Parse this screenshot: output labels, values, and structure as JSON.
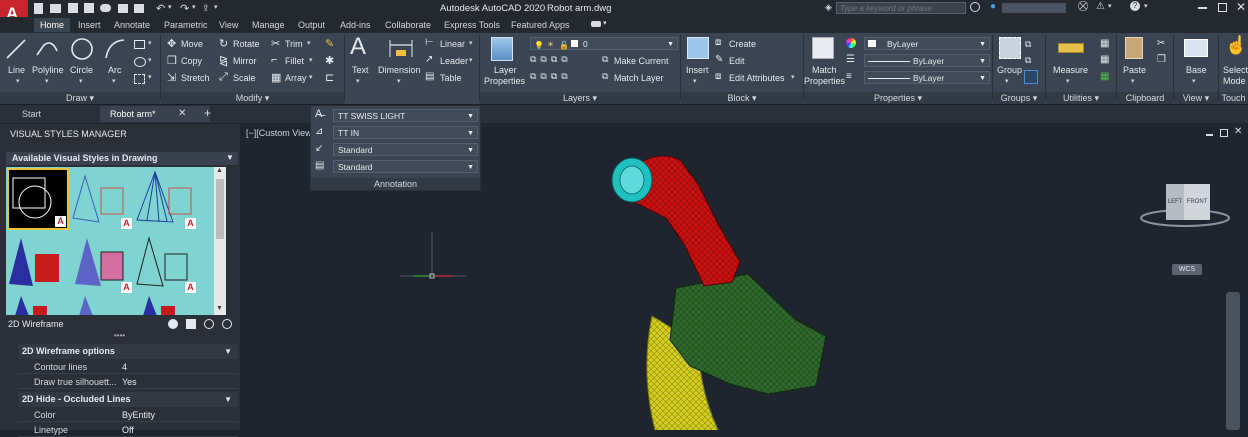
{
  "app": {
    "logo_letter": "A",
    "title": "Autodesk AutoCAD 2020",
    "filename": "Robot arm.dwg",
    "search_placeholder": "Type a keyword or phrase"
  },
  "ribbon_tabs": [
    "Home",
    "Insert",
    "Annotate",
    "Parametric",
    "View",
    "Manage",
    "Output",
    "Add-ins",
    "Collaborate",
    "Express Tools",
    "Featured Apps"
  ],
  "draw": {
    "label": "Draw",
    "line": "Line",
    "polyline": "Polyline",
    "circle": "Circle",
    "arc": "Arc"
  },
  "modify": {
    "label": "Modify",
    "move": "Move",
    "rotate": "Rotate",
    "trim": "Trim",
    "copy": "Copy",
    "mirror": "Mirror",
    "fillet": "Fillet",
    "stretch": "Stretch",
    "scale": "Scale",
    "array": "Array"
  },
  "annotation": {
    "label": "Annotation",
    "text": "Text",
    "dimension": "Dimension",
    "linear": "Linear",
    "leader": "Leader",
    "table": "Table",
    "dropdowns": [
      "TT SWISS LIGHT",
      "TT IN",
      "Standard",
      "Standard"
    ]
  },
  "layers": {
    "label": "Layers",
    "layer_properties_1": "Layer",
    "layer_properties_2": "Properties",
    "current_layer": "0",
    "make_current": "Make Current",
    "match_layer": "Match Layer"
  },
  "block": {
    "label": "Block",
    "insert": "Insert",
    "create": "Create",
    "edit": "Edit",
    "edit_attributes": "Edit Attributes"
  },
  "properties": {
    "label": "Properties",
    "match_1": "Match",
    "match_2": "Properties",
    "color": "ByLayer",
    "linetype": "ByLayer",
    "lineweight": "ByLayer"
  },
  "groups": {
    "label": "Groups",
    "group": "Group"
  },
  "utilities": {
    "label": "Utilities",
    "measure": "Measure"
  },
  "clipboard": {
    "label": "Clipboard",
    "paste": "Paste"
  },
  "view_panel": {
    "label": "View",
    "base": "Base"
  },
  "touch": {
    "select_1": "Select",
    "select_2": "Mode",
    "label": "Touch"
  },
  "file_tabs": {
    "start": "Start",
    "doc": "Robot arm*",
    "add": "+"
  },
  "viewport": {
    "label": "[−][Custom View"
  },
  "viewcube": {
    "left": "LEFT",
    "front": "FRONT",
    "wcs": "WCS"
  },
  "vsm": {
    "title": "VISUAL STYLES MANAGER",
    "section": "Available Visual Styles in Drawing",
    "current_style": "2D Wireframe",
    "groups": [
      {
        "heading": "2D Wireframe options",
        "rows": [
          {
            "name": "Contour lines",
            "value": "4"
          },
          {
            "name": "Draw true silhouett...",
            "value": "Yes"
          }
        ]
      },
      {
        "heading": "2D Hide - Occluded Lines",
        "rows": [
          {
            "name": "Color",
            "value": "ByEntity"
          },
          {
            "name": "Linetype",
            "value": "Off"
          }
        ]
      }
    ]
  },
  "colors": {
    "ribbon": "#3b4452",
    "titlebar": "#24292f",
    "accent": "#c8242b",
    "viewport": "#1f252f",
    "arm_red": "#cc1111",
    "arm_green": "#2f6a2c",
    "arm_yellow": "#d4cf1e",
    "swatch_cyan": "#7fd3d0"
  }
}
